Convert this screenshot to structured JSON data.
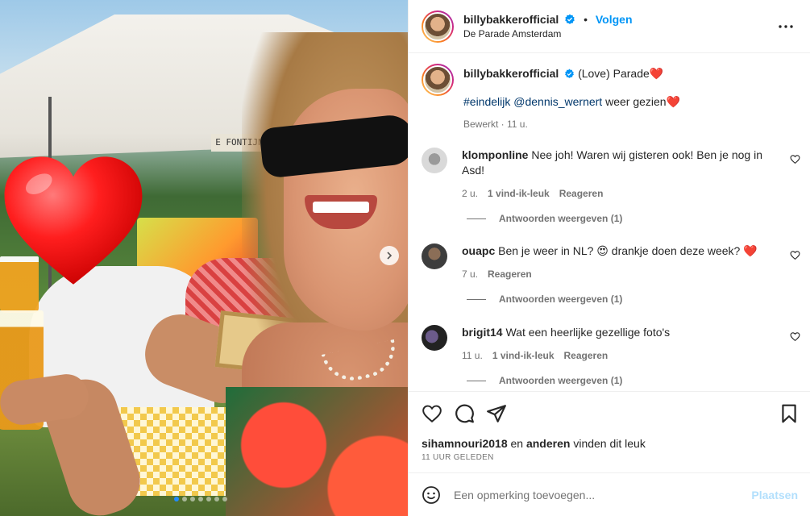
{
  "post": {
    "username": "billybakkerofficial",
    "follow_label": "Volgen",
    "location": "De Parade Amsterdam",
    "verified": true
  },
  "photo": {
    "sign_text": "E FONTIJN",
    "carousel_dots": 7,
    "active_dot": 0
  },
  "caption": {
    "username": "billybakkerofficial",
    "line1": "(Love) Parade❤️",
    "hashtag": "#eindelijk",
    "mention": "@dennis_wernert",
    "line2_rest": " weer gezien❤️",
    "meta": "Bewerkt · 11 u."
  },
  "comments": [
    {
      "username": "klomponline",
      "text": "Nee joh! Waren wij gisteren ook! Ben je nog in Asd!",
      "time": "2 u.",
      "likes": "1 vind-ik-leuk",
      "reply": "Reageren",
      "replies_label": "Antwoorden weergeven (1)"
    },
    {
      "username": "ouapc",
      "text": "Ben je weer in NL? 😍 drankje doen deze week? ❤️",
      "time": "7 u.",
      "likes": "",
      "reply": "Reageren",
      "replies_label": "Antwoorden weergeven (1)"
    },
    {
      "username": "brigit14",
      "text": "Wat een heerlijke gezellige foto's",
      "time": "11 u.",
      "likes": "1 vind-ik-leuk",
      "reply": "Reageren",
      "replies_label": "Antwoorden weergeven (1)"
    }
  ],
  "likes_line": {
    "user": "sihamnouri2018",
    "middle": " en ",
    "others": "anderen",
    "suffix": " vinden dit leuk"
  },
  "timestamp": "11 UUR GELEDEN",
  "add_comment": {
    "placeholder": "Een opmerking toevoegen...",
    "post_label": "Plaatsen"
  },
  "colors": {
    "follow": "#0095f6",
    "link": "#00376b",
    "muted": "#737373",
    "post_disabled": "#b2dffc",
    "heart": "#ff2a2a"
  },
  "icons": [
    "heart-icon",
    "comment-icon",
    "share-icon",
    "bookmark-icon",
    "more-icon",
    "emoji-icon",
    "verified-icon",
    "chevron-right-icon"
  ]
}
